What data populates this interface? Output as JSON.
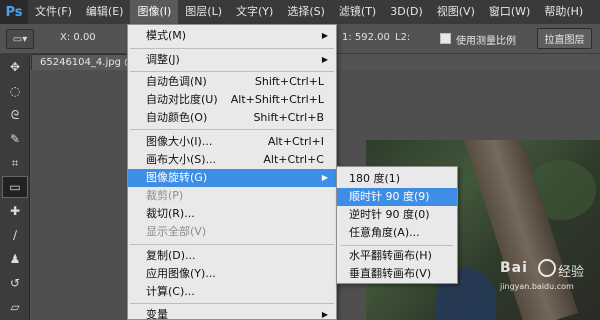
{
  "app": {
    "logo": "Ps"
  },
  "menubar": {
    "items": [
      "文件(F)",
      "编辑(E)",
      "图像(I)",
      "图层(L)",
      "文字(Y)",
      "选择(S)",
      "滤镜(T)",
      "3D(D)",
      "视图(V)",
      "窗口(W)",
      "帮助(H)"
    ],
    "active_index": 2
  },
  "options": {
    "x_label": "X: 0.00",
    "y_partial": "1: 592.00",
    "l2_label": "L2:",
    "measure_scale_label": "使用测量比例",
    "measure_scale_checked": false,
    "straighten_button": "拉直图层"
  },
  "document": {
    "tab_title": "65246104_4.jpg @"
  },
  "image_menu": {
    "items": [
      {
        "label": "模式(M)",
        "shortcut": "",
        "submenu": true,
        "disabled": false
      },
      {
        "label": "调整(J)",
        "shortcut": "",
        "submenu": true,
        "disabled": false
      },
      {
        "label": "自动色调(N)",
        "shortcut": "Shift+Ctrl+L",
        "submenu": false,
        "disabled": false
      },
      {
        "label": "自动对比度(U)",
        "shortcut": "Alt+Shift+Ctrl+L",
        "submenu": false,
        "disabled": false
      },
      {
        "label": "自动颜色(O)",
        "shortcut": "Shift+Ctrl+B",
        "submenu": false,
        "disabled": false
      },
      {
        "label": "图像大小(I)...",
        "shortcut": "Alt+Ctrl+I",
        "submenu": false,
        "disabled": false
      },
      {
        "label": "画布大小(S)...",
        "shortcut": "Alt+Ctrl+C",
        "submenu": false,
        "disabled": false
      },
      {
        "label": "图像旋转(G)",
        "shortcut": "",
        "submenu": true,
        "disabled": false
      },
      {
        "label": "裁剪(P)",
        "shortcut": "",
        "submenu": false,
        "disabled": true
      },
      {
        "label": "裁切(R)...",
        "shortcut": "",
        "submenu": false,
        "disabled": false
      },
      {
        "label": "显示全部(V)",
        "shortcut": "",
        "submenu": false,
        "disabled": true
      },
      {
        "label": "复制(D)...",
        "shortcut": "",
        "submenu": false,
        "disabled": false
      },
      {
        "label": "应用图像(Y)...",
        "shortcut": "",
        "submenu": false,
        "disabled": false
      },
      {
        "label": "计算(C)...",
        "shortcut": "",
        "submenu": false,
        "disabled": false
      },
      {
        "label": "变量",
        "shortcut": "",
        "submenu": true,
        "disabled": false
      }
    ],
    "selected_index": 7
  },
  "rotate_submenu": {
    "items": [
      "180 度(1)",
      "顺时针 90 度(9)",
      "逆时针 90 度(0)",
      "任意角度(A)...",
      "水平翻转画布(H)",
      "垂直翻转画布(V)"
    ],
    "selected_index": 1
  },
  "watermark": {
    "logo_left": "Bai",
    "logo_right": "经验",
    "url": "jingyan.baidu.com"
  }
}
